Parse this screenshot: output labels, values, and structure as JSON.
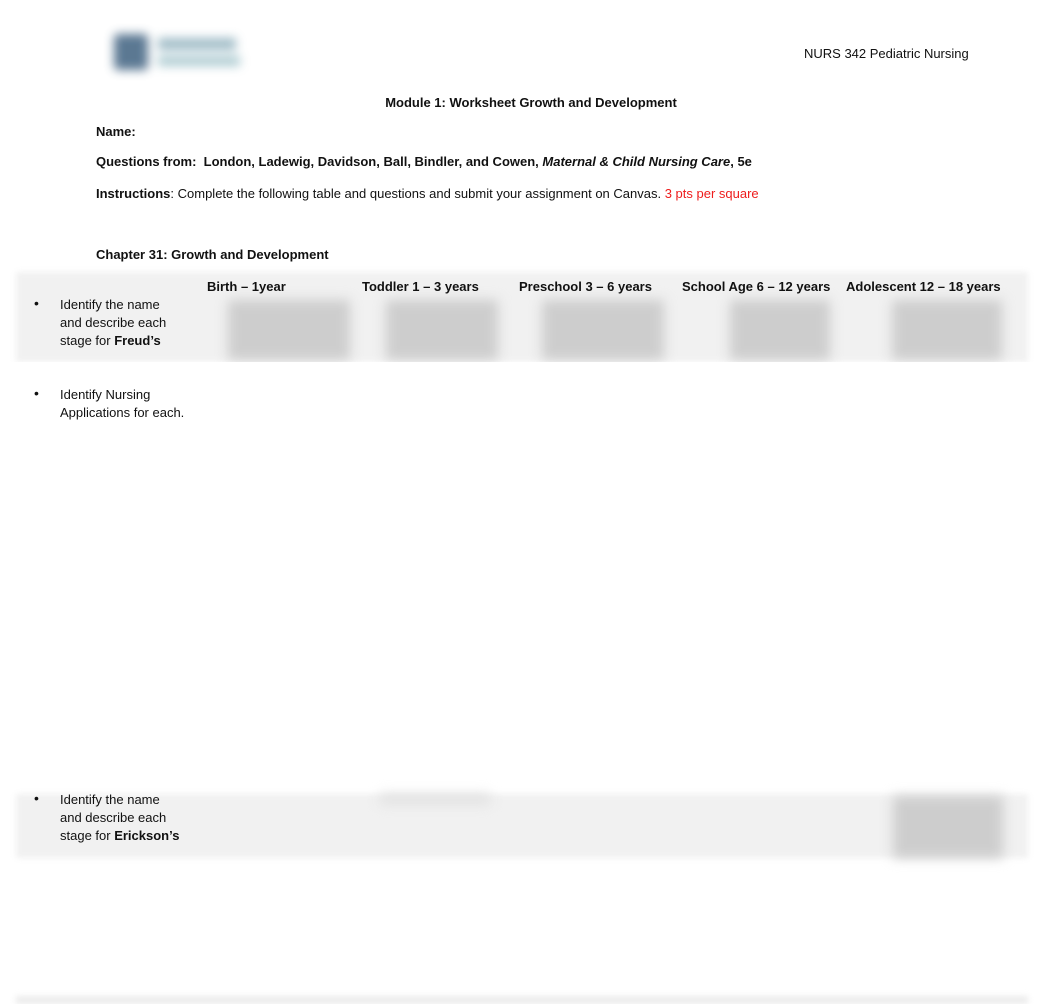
{
  "header": {
    "logo": "university-logo",
    "course": "NURS 342 Pediatric Nursing"
  },
  "document": {
    "title": "Module 1:  Worksheet Growth and Development",
    "name_label": "Name:",
    "questions_label": "Questions from:",
    "questions_authors": "London, Ladewig, Davidson, Ball, Bindler, and Cowen,",
    "questions_book": "Maternal & Child Nursing Care",
    "questions_edition": ", 5e",
    "instructions_label": "Instructions",
    "instructions_text": ":  Complete the following table and questions and submit your assignment on Canvas.",
    "instructions_points": "3 pts per square",
    "chapter_heading": "Chapter 31:  Growth and Development"
  },
  "table": {
    "columns": [
      "Birth – 1year",
      "Toddler 1 – 3 years",
      "Preschool 3 – 6 years",
      "School Age 6 – 12 years",
      "Adolescent 12 – 18 years"
    ],
    "rows": [
      {
        "bullet": "•",
        "text": "Identify the name and describe each stage for ",
        "bold": "Freud’s"
      },
      {
        "bullet": "•",
        "text": "Identify Nursing Applications for each.",
        "bold": ""
      },
      {
        "bullet": "•",
        "text": "Identify the name and describe each stage for ",
        "bold": "Erickson’s"
      }
    ]
  },
  "colors": {
    "points_text": "#ee1c1c",
    "blurred_band": "#f1f1f1",
    "blurred_cell": "#cdcdcd"
  }
}
